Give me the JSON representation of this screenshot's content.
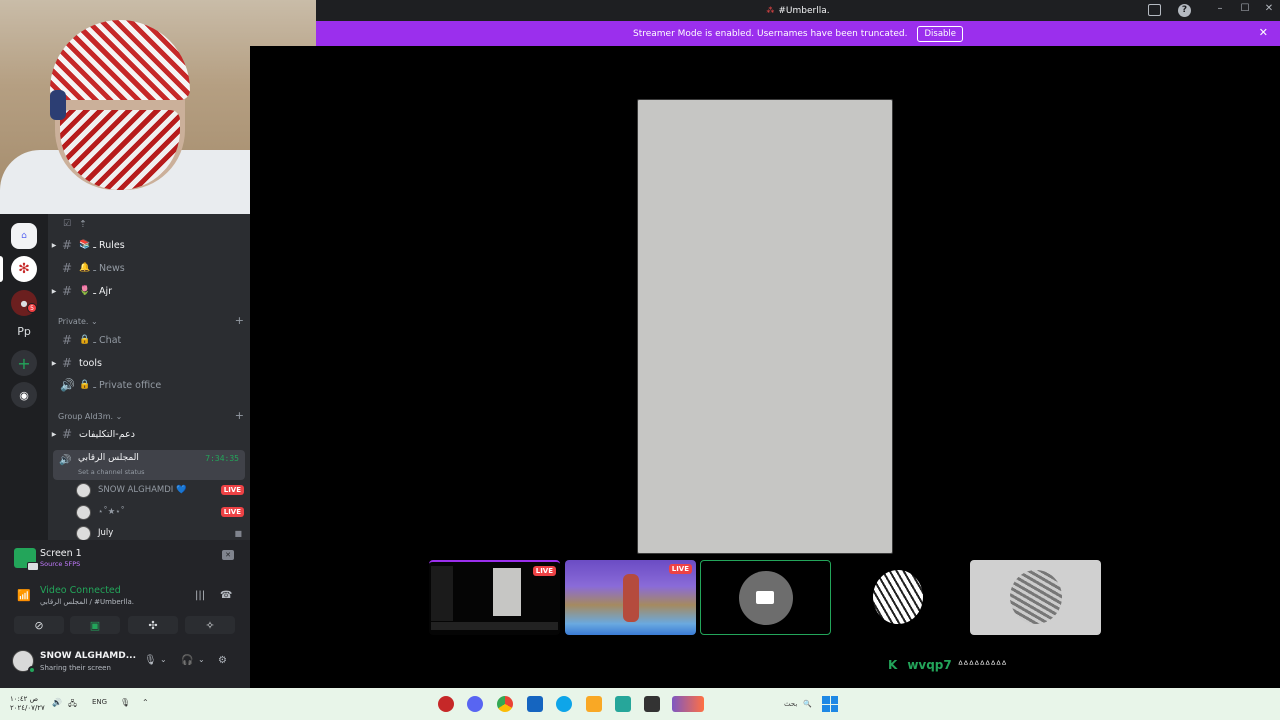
{
  "window": {
    "title": "#Umberlla.",
    "help_label": "?"
  },
  "banner": {
    "text": "Streamer Mode is enabled. Usernames have been truncated.",
    "disable_label": "Disable",
    "close_label": "✕"
  },
  "rail": {
    "dm_label": "",
    "pp_label": "Pp",
    "add_label": "+",
    "explore_label": "◉",
    "badge_count": "5"
  },
  "channels": {
    "items": [
      {
        "label": "ـ Rules",
        "emoji": "📚"
      },
      {
        "label": "ـ News",
        "emoji": "🔔"
      },
      {
        "label": "ـ Ajr",
        "emoji": "🌷"
      }
    ],
    "private_category": "Private.",
    "private_items": [
      {
        "label": "ـ Chat"
      },
      {
        "label": "tools"
      },
      {
        "label": "ـ Private office"
      }
    ],
    "group_category": "Group Ald3m.",
    "group_text_channel": "دعم-التكليفات",
    "voice_channel": {
      "name": "المجلس الرقابي",
      "timer": "7:34:35",
      "status_placeholder": "Set a channel status"
    },
    "members": [
      {
        "name": "SNOW ALGHAMDI 💙",
        "live": "LIVE"
      },
      {
        "name": "⋆˚★⋆˚",
        "live": "LIVE"
      },
      {
        "name": "July",
        "live": ""
      }
    ]
  },
  "panel": {
    "screen_title": "Screen 1",
    "screen_sub": "Source 5FPS",
    "video_status": "Video Connected",
    "video_channel": "المجلس الرقابي / #Umberlla.",
    "username": "SNOW ALGHAMD...",
    "user_status": "Sharing their screen"
  },
  "stage": {
    "tiles": [
      {
        "live": "LIVE"
      },
      {
        "live": "LIVE"
      }
    ],
    "overlay_user": "wvqp7",
    "overlay_tail": "ᐞᐞᐞᐞᐞᐞᐞᐞᐞ"
  },
  "taskbar": {
    "clock_line1": "ص ١٠:٤٢",
    "clock_line2": "٢٠٢٤/٠٧/٢٧",
    "lang": "ENG",
    "search_label": "بحث"
  },
  "colors": {
    "banner": "#9b2fed",
    "online": "#23a55a",
    "live": "#ed4245"
  }
}
